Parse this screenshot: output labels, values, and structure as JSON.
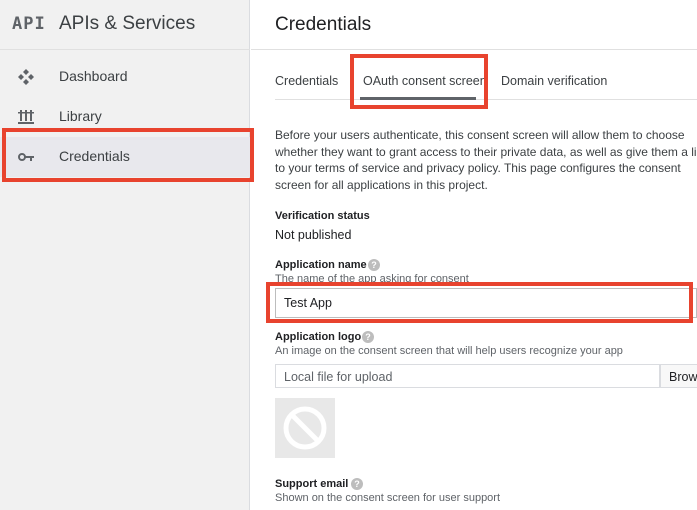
{
  "app": {
    "logo_text": "API",
    "title": "APIs & Services"
  },
  "sidebar": {
    "items": [
      {
        "label": "Dashboard",
        "icon": "dashboard-icon"
      },
      {
        "label": "Library",
        "icon": "library-icon"
      },
      {
        "label": "Credentials",
        "icon": "key-icon",
        "active": true
      }
    ]
  },
  "header": {
    "title": "Credentials"
  },
  "tabs": [
    {
      "label": "Credentials"
    },
    {
      "label": "OAuth consent screen",
      "active": true
    },
    {
      "label": "Domain verification"
    }
  ],
  "main": {
    "description_lines": [
      "Before your users authenticate, this consent screen will allow them to choose",
      "whether they want to grant access to their private data, as well as give them a link",
      "to your terms of service and privacy policy. This page configures the consent",
      "screen for all applications in this project."
    ],
    "verification": {
      "label": "Verification status",
      "value": "Not published"
    },
    "application_name": {
      "label": "Application name",
      "hint": "The name of the app asking for consent",
      "value": "Test App"
    },
    "application_logo": {
      "label": "Application logo",
      "hint": "An image on the consent screen that will help users recognize your app",
      "placeholder": "Local file for upload",
      "browse_label": "Browse"
    },
    "support_email": {
      "label": "Support email",
      "hint": "Shown on the consent screen for user support"
    }
  },
  "colors": {
    "highlight": "#e8432e",
    "sidebar_bg": "#f1f1f1"
  }
}
